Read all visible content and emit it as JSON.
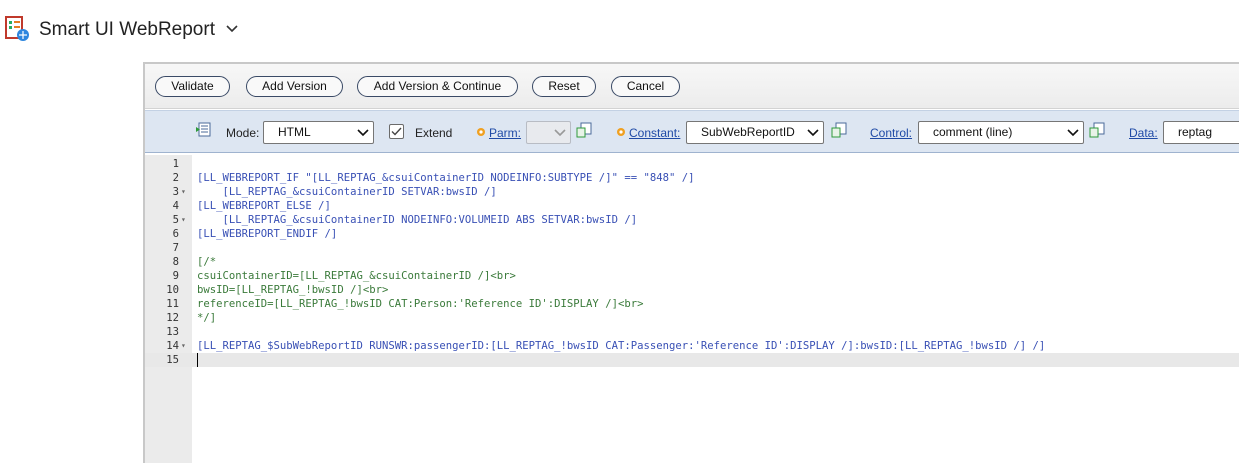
{
  "app": {
    "title": "Smart UI WebReport"
  },
  "buttons": {
    "validate": "Validate",
    "add_version": "Add Version",
    "add_version_continue": "Add Version & Continue",
    "reset": "Reset",
    "cancel": "Cancel"
  },
  "toolbar": {
    "mode_label": "Mode:",
    "mode_value": "HTML",
    "extend_label": "Extend",
    "parm_label": "Parm:",
    "parm_value": "",
    "constant_label": "Constant:",
    "constant_value": "SubWebReportID",
    "control_label": "Control:",
    "control_value": "comment (line)",
    "data_label": "Data:",
    "data_value": "reptag"
  },
  "code": {
    "lines": [
      {
        "n": "1",
        "fold": "",
        "text": ""
      },
      {
        "n": "2",
        "fold": "",
        "text": "[LL_WEBREPORT_IF \"[LL_REPTAG_&csuiContainerID NODEINFO:SUBTYPE /]\" == \"848\" /]"
      },
      {
        "n": "3",
        "fold": "▾",
        "text": "    [LL_REPTAG_&csuiContainerID SETVAR:bwsID /]"
      },
      {
        "n": "4",
        "fold": "",
        "text": "[LL_WEBREPORT_ELSE /]"
      },
      {
        "n": "5",
        "fold": "▾",
        "text": "    [LL_REPTAG_&csuiContainerID NODEINFO:VOLUMEID ABS SETVAR:bwsID /]"
      },
      {
        "n": "6",
        "fold": "",
        "text": "[LL_WEBREPORT_ENDIF /]"
      },
      {
        "n": "7",
        "fold": "",
        "text": ""
      },
      {
        "n": "8",
        "fold": "",
        "text": "[/*"
      },
      {
        "n": "9",
        "fold": "",
        "text": "csuiContainerID=[LL_REPTAG_&csuiContainerID /]<br>"
      },
      {
        "n": "10",
        "fold": "",
        "text": "bwsID=[LL_REPTAG_!bwsID /]<br>"
      },
      {
        "n": "11",
        "fold": "",
        "text": "referenceID=[LL_REPTAG_!bwsID CAT:Person:'Reference ID':DISPLAY /]<br>"
      },
      {
        "n": "12",
        "fold": "",
        "text": "*/]"
      },
      {
        "n": "13",
        "fold": "",
        "text": ""
      },
      {
        "n": "14",
        "fold": "▾",
        "text": "[LL_REPTAG_$SubWebReportID RUNSWR:passengerID:[LL_REPTAG_!bwsID CAT:Passenger:'Reference ID':DISPLAY /]:bwsID:[LL_REPTAG_!bwsID /] /]"
      },
      {
        "n": "15",
        "fold": "",
        "text": ""
      }
    ]
  },
  "colors": {
    "tag": "#3950b5",
    "comment": "#3a7a3a",
    "toolbar_bg": "#dde6f2",
    "gutter_bg": "#ebebeb"
  }
}
